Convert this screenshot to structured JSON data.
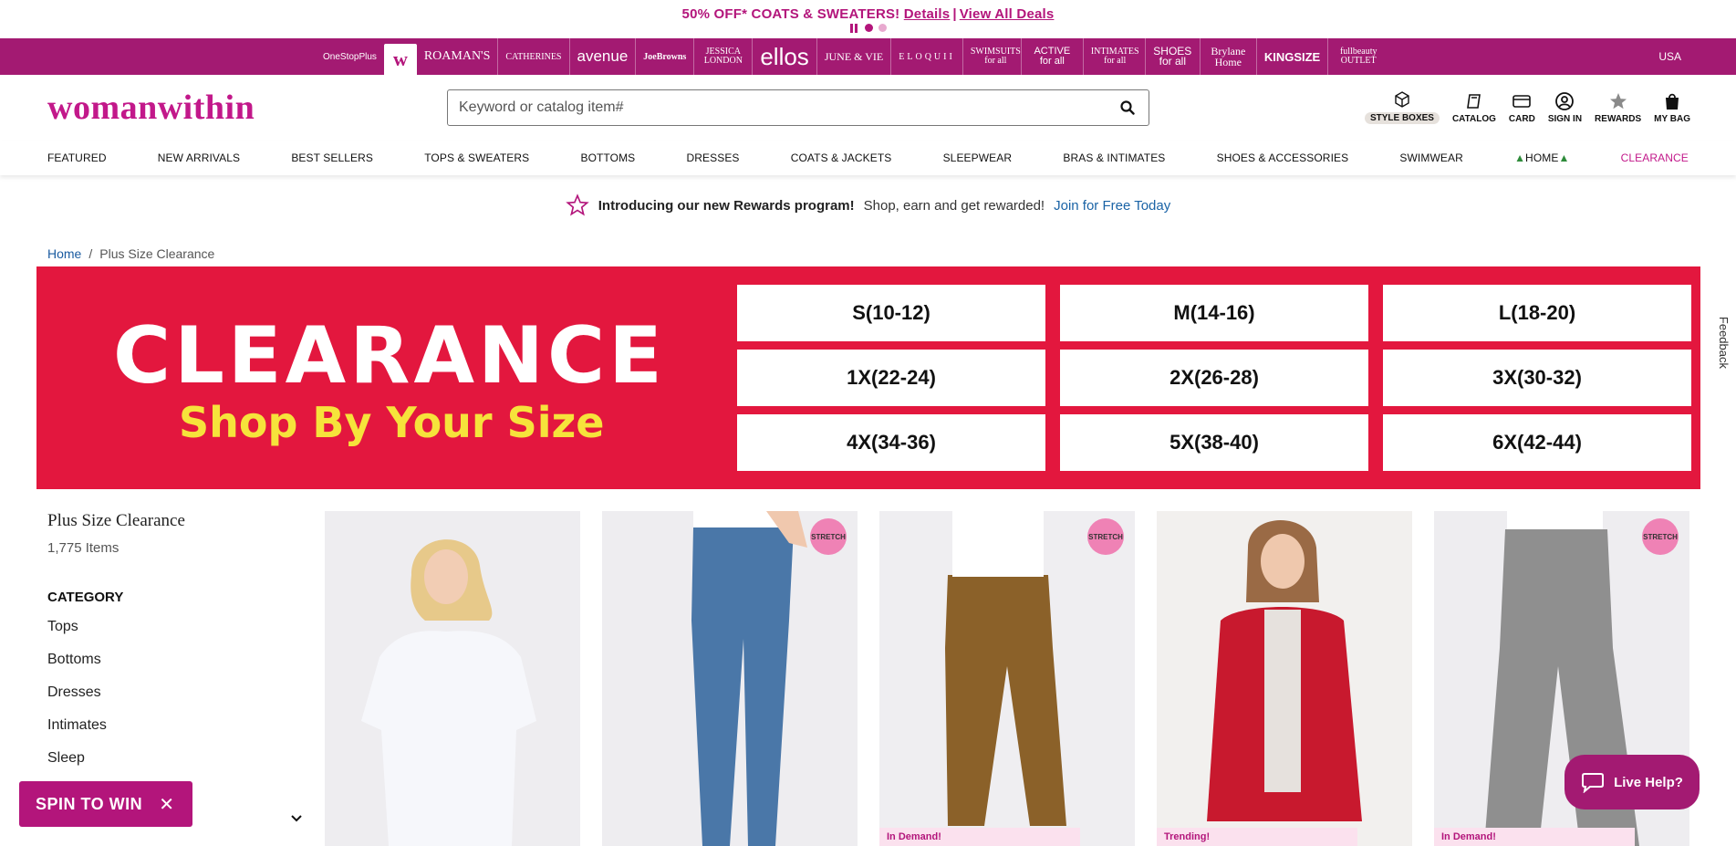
{
  "promo": {
    "headline": "50% OFF* COATS & SWEATERS!",
    "details_link": "Details",
    "deals_link": "View All Deals"
  },
  "brands": {
    "onestop": "OneStopPlus",
    "active_logo": "w",
    "items": [
      "ROAMAN'S",
      "CATHERINES",
      "avenue",
      "JoeBrowns",
      "JESSICA LONDON",
      "ellos",
      "JUNE & VIE",
      "ELOQUII",
      "SWIMSUITS for all",
      "ACTIVE for all",
      "INTIMATES for all",
      "SHOES for all",
      "Brylane Home",
      "KINGSIZE",
      "fullbeauty OUTLET"
    ],
    "country": "USA"
  },
  "header": {
    "logo": "womanwithin",
    "search_placeholder": "Keyword or catalog item#",
    "utils": {
      "style_boxes": "STYLE BOXES",
      "catalog": "CATALOG",
      "card": "CARD",
      "sign_in": "SIGN IN",
      "rewards": "REWARDS",
      "bag": "MY BAG"
    }
  },
  "nav": [
    "FEATURED",
    "NEW ARRIVALS",
    "BEST SELLERS",
    "TOPS & SWEATERS",
    "BOTTOMS",
    "DRESSES",
    "COATS & JACKETS",
    "SLEEPWEAR",
    "BRAS & INTIMATES",
    "SHOES & ACCESSORIES",
    "SWIMWEAR",
    "HOME",
    "CLEARANCE"
  ],
  "rewards_strip": {
    "bold": "Introducing our new Rewards program!",
    "text": "Shop, earn and get rewarded!",
    "link": "Join for Free Today"
  },
  "breadcrumb": {
    "home": "Home",
    "sep": "/",
    "current": "Plus Size Clearance"
  },
  "hero": {
    "title": "CLEARANCE",
    "subtitle": "Shop By Your Size",
    "sizes": [
      "S(10-12)",
      "M(14-16)",
      "L(18-20)",
      "1X(22-24)",
      "2X(26-28)",
      "3X(30-32)",
      "4X(34-36)",
      "5X(38-40)",
      "6X(42-44)"
    ]
  },
  "feedback": "Feedback",
  "sidebar": {
    "title": "Plus Size Clearance",
    "count": "1,775 Items",
    "category_heading": "CATEGORY",
    "categories": [
      "Tops",
      "Bottoms",
      "Dresses",
      "Intimates",
      "Sleep"
    ]
  },
  "products": {
    "badge": "STRETCH",
    "tag_in_demand": "In Demand!",
    "tag_trending": "Trending!"
  },
  "spin": {
    "label": "SPIN TO WIN",
    "close": "✕"
  },
  "live_help": "Live Help?",
  "colors": {
    "brand_magenta": "#b3157b",
    "brand_bar": "#a31a72",
    "hero_red": "#e3173e",
    "hero_yellow": "#f6e33b"
  }
}
